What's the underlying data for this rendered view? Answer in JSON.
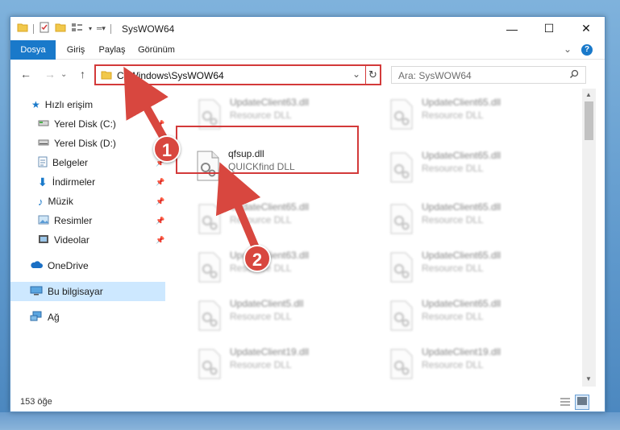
{
  "window": {
    "title": "SysWOW64",
    "controls": {
      "minimize": "—",
      "maximize": "☐",
      "close": "✕"
    }
  },
  "ribbon": {
    "tabs": [
      {
        "label": "Dosya",
        "active": true
      },
      {
        "label": "Giriş"
      },
      {
        "label": "Paylaş"
      },
      {
        "label": "Görünüm"
      }
    ],
    "expand_icon": "chevron-down-icon",
    "help_icon": "help-icon"
  },
  "address": {
    "path": "C:\\Windows\\SysWOW64",
    "search_placeholder": "Ara: SysWOW64"
  },
  "sidebar": {
    "items": [
      {
        "label": "Hızlı erişim",
        "icon": "star-icon"
      },
      {
        "label": "Yerel Disk (C:)",
        "icon": "drive-icon",
        "pinned": true
      },
      {
        "label": "Yerel Disk (D:)",
        "icon": "drive-icon",
        "pinned": true
      },
      {
        "label": "Belgeler",
        "icon": "documents-icon",
        "pinned": true
      },
      {
        "label": "İndirmeler",
        "icon": "downloads-icon",
        "pinned": true
      },
      {
        "label": "Müzik",
        "icon": "music-icon",
        "pinned": true
      },
      {
        "label": "Resimler",
        "icon": "pictures-icon",
        "pinned": true
      },
      {
        "label": "Videolar",
        "icon": "videos-icon",
        "pinned": true
      },
      {
        "label": "OneDrive",
        "icon": "cloud-icon"
      },
      {
        "label": "Bu bilgisayar",
        "icon": "computer-icon",
        "selected": true
      },
      {
        "label": "Ağ",
        "icon": "network-icon"
      }
    ]
  },
  "files": {
    "highlighted": {
      "name": "qfsup.dll",
      "type": "QUICKfind DLL"
    },
    "left_column": [
      {
        "name": "UpdateClient63.dll",
        "type": "Resource DLL"
      },
      {
        "name": "UpdateClient65.dll",
        "type": "Resource DLL"
      },
      {
        "name": "UpdateClient63.dll",
        "type": "Resource DLL"
      },
      {
        "name": "UpdateClient5.dll",
        "type": "Resource DLL"
      },
      {
        "name": "UpdateClient19.dll",
        "type": "Resource DLL"
      }
    ],
    "right_column": [
      {
        "name": "UpdateClient65.dll",
        "type": "Resource DLL"
      },
      {
        "name": "UpdateClient65.dll",
        "type": "Resource DLL"
      },
      {
        "name": "UpdateClient65.dll",
        "type": "Resource DLL"
      },
      {
        "name": "UpdateClient65.dll",
        "type": "Resource DLL"
      },
      {
        "name": "UpdateClient65.dll",
        "type": "Resource DLL"
      },
      {
        "name": "UpdateClient19.dll",
        "type": "Resource DLL"
      }
    ]
  },
  "status": {
    "count": "153 öğe"
  },
  "annotations": {
    "step1": "1",
    "step2": "2",
    "color": "#d8473f"
  }
}
